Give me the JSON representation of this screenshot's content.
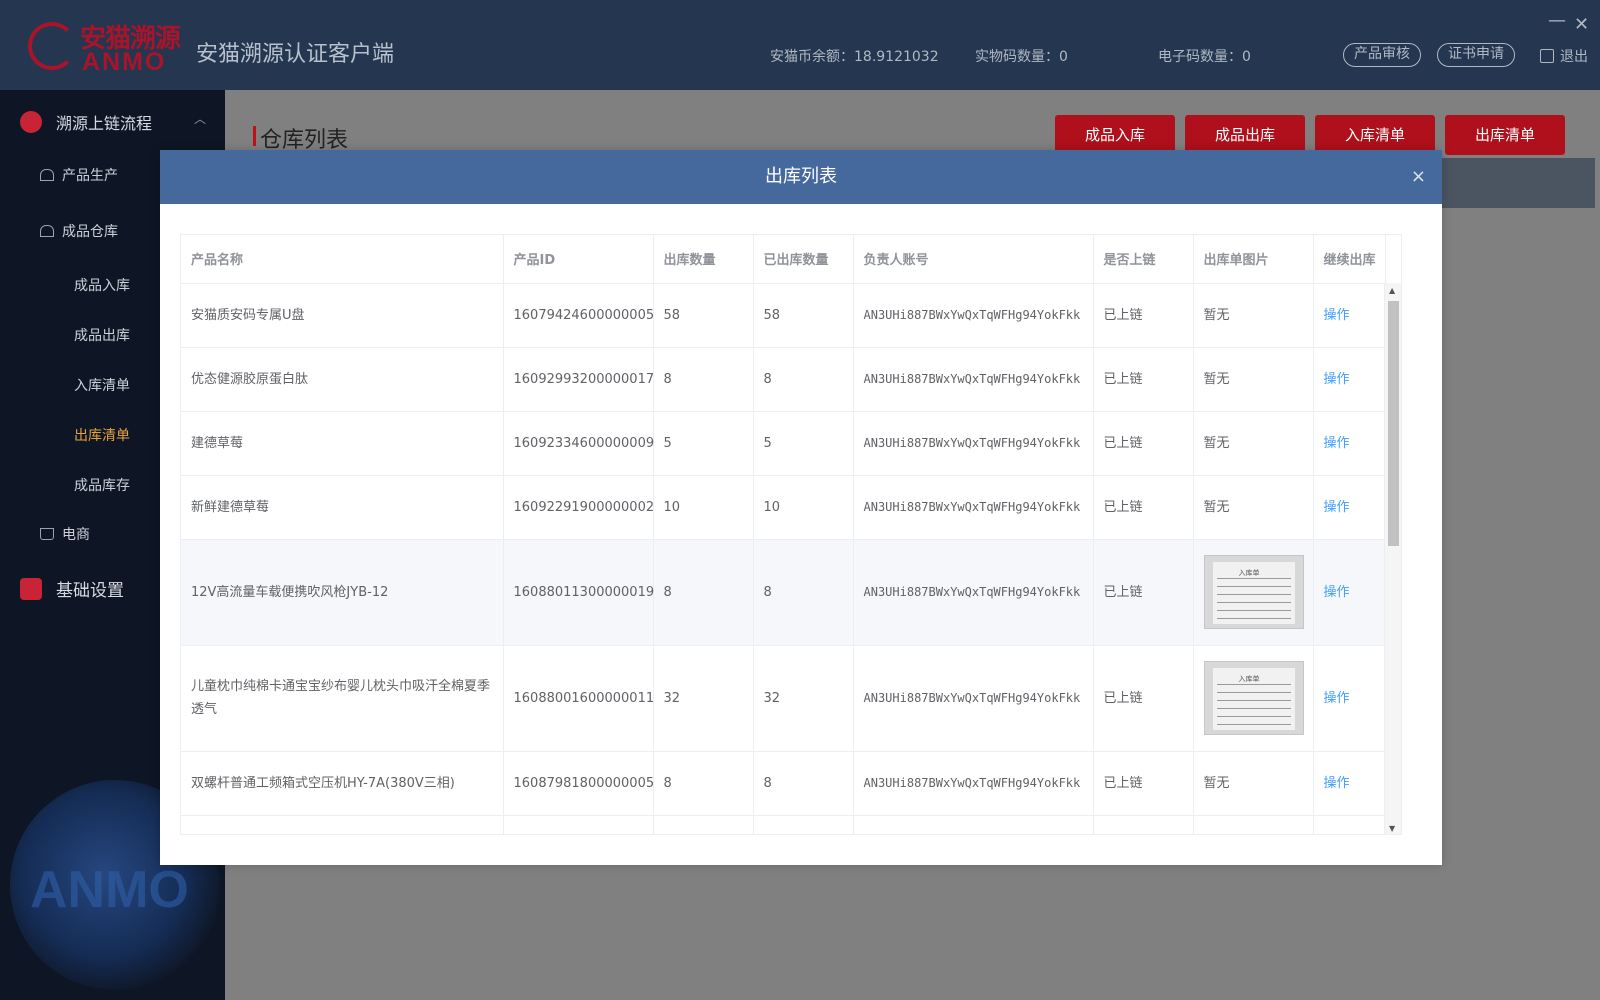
{
  "header": {
    "logo_cn": "安猫溯源",
    "logo_en": "ANMO",
    "app_title": "安猫溯源认证客户端",
    "balance": "安猫币余额：18.9121032",
    "physical_count": "实物码数量：0",
    "ecode_count": "电子码数量：0",
    "btn_product_review": "产品审核",
    "btn_cert_apply": "证书申请",
    "logout": "退出",
    "minimize": "—",
    "close": "✕"
  },
  "sidebar": {
    "section1": "溯源上链流程",
    "items": [
      {
        "label": "产品生产"
      },
      {
        "label": "成品仓库"
      },
      {
        "label": "成品入库"
      },
      {
        "label": "成品出库"
      },
      {
        "label": "入库清单"
      },
      {
        "label": "出库清单"
      },
      {
        "label": "成品库存"
      },
      {
        "label": "电商"
      }
    ],
    "section2": "基础设置",
    "watermark": "ANMO"
  },
  "main": {
    "page_title": "仓库列表",
    "buttons": [
      "成品入库",
      "成品出库",
      "入库清单",
      "出库清单"
    ]
  },
  "modal": {
    "title": "出库列表",
    "close": "×",
    "columns": [
      "产品名称",
      "产品ID",
      "出库数量",
      "已出库数量",
      "负责人账号",
      "是否上链",
      "出库单图片",
      "继续出库"
    ],
    "rows": [
      {
        "name": "安猫质安码专属U盘",
        "id": "16079424600000005",
        "qty": "58",
        "done": "58",
        "account": "AN3UHi887BWxYwQxTqWFHg94YokFkk",
        "chain": "已上链",
        "image": "暂无",
        "action": "操作"
      },
      {
        "name": "优态健源胶原蛋白肽",
        "id": "16092993200000017",
        "qty": "8",
        "done": "8",
        "account": "AN3UHi887BWxYwQxTqWFHg94YokFkk",
        "chain": "已上链",
        "image": "暂无",
        "action": "操作"
      },
      {
        "name": "建德草莓",
        "id": "16092334600000009",
        "qty": "5",
        "done": "5",
        "account": "AN3UHi887BWxYwQxTqWFHg94YokFkk",
        "chain": "已上链",
        "image": "暂无",
        "action": "操作"
      },
      {
        "name": "新鲜建德草莓",
        "id": "16092291900000002",
        "qty": "10",
        "done": "10",
        "account": "AN3UHi887BWxYwQxTqWFHg94YokFkk",
        "chain": "已上链",
        "image": "暂无",
        "action": "操作"
      },
      {
        "name": "12V高流量车载便携吹风枪JYB-12",
        "id": "16088011300000019",
        "qty": "8",
        "done": "8",
        "account": "AN3UHi887BWxYwQxTqWFHg94YokFkk",
        "chain": "已上链",
        "image": "",
        "action": "操作"
      },
      {
        "name": "儿童枕巾纯棉卡通宝宝纱布婴儿枕头巾吸汗全棉夏季透气",
        "id": "16088001600000011",
        "qty": "32",
        "done": "32",
        "account": "AN3UHi887BWxYwQxTqWFHg94YokFkk",
        "chain": "已上链",
        "image": "",
        "action": "操作"
      },
      {
        "name": "双螺杆普通工频箱式空压机HY-7A(380V三相)",
        "id": "16087981800000005",
        "qty": "8",
        "done": "8",
        "account": "AN3UHi887BWxYwQxTqWFHg94YokFkk",
        "chain": "已上链",
        "image": "暂无",
        "action": "操作"
      }
    ],
    "receipt_title": "入库单"
  }
}
